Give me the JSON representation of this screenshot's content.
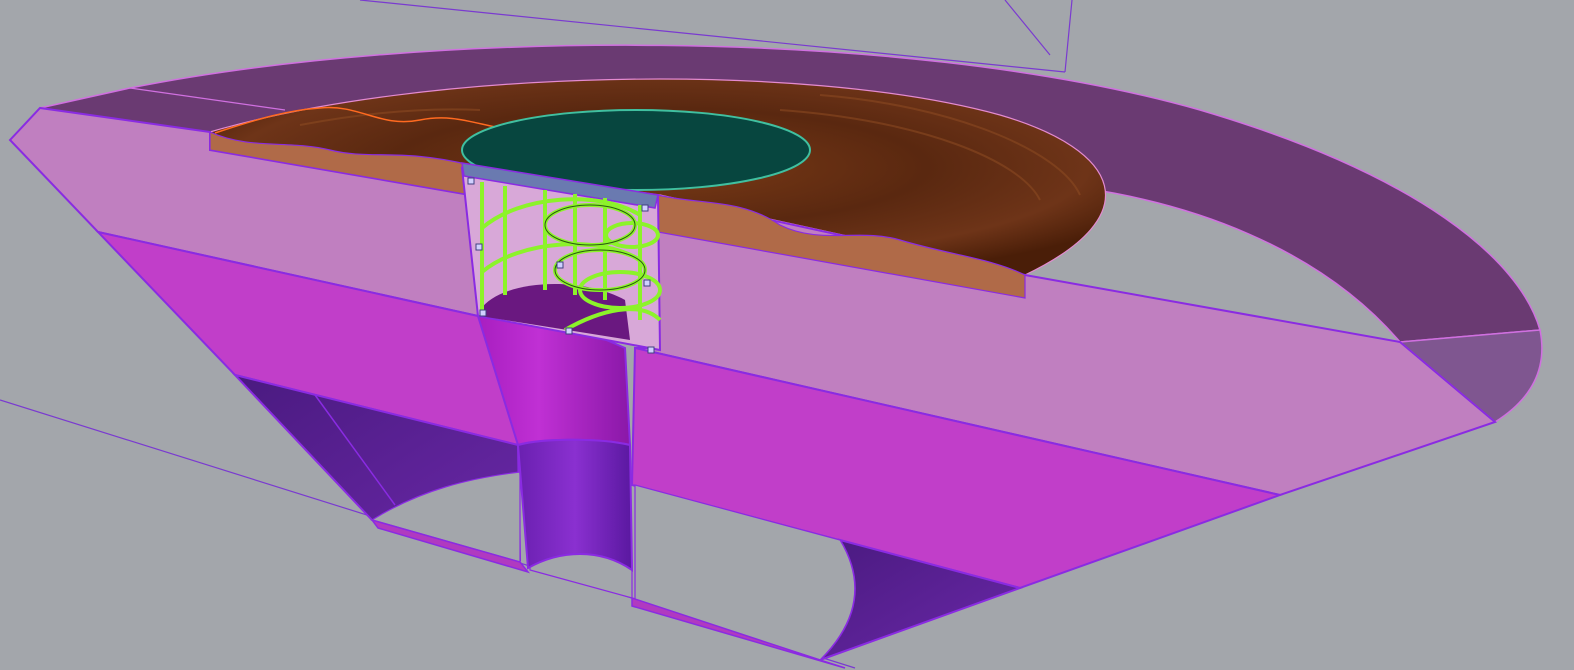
{
  "viewport": {
    "background": "#a3a6ab",
    "model": "sectioned-circular-basin"
  },
  "colors": {
    "edge": "#8a2be2",
    "face_light": "#c07fc0",
    "face_mid": "#c13ec9",
    "face_dark": "#5a2a8a",
    "rim_top": "#6a3a72",
    "bowl_brown": "#5c2a10",
    "water": "#0a4a44",
    "cage": "#8cf32a",
    "soil": "#b06a48"
  }
}
